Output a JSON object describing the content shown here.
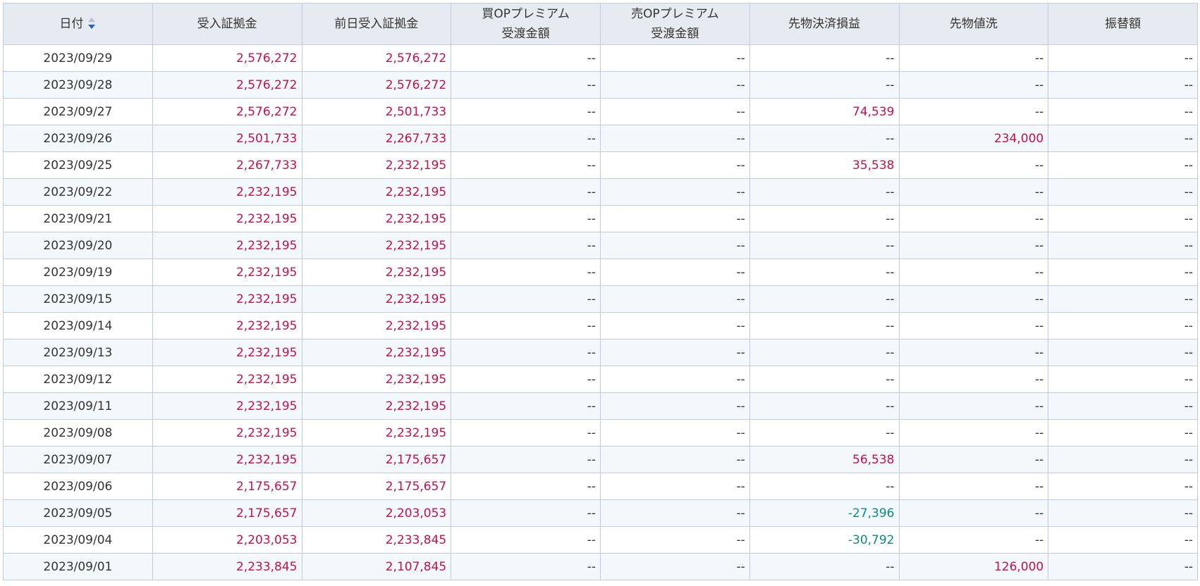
{
  "table": {
    "headers": [
      {
        "lines": [
          "日付"
        ],
        "sortable": true
      },
      {
        "lines": [
          "受入証拠金"
        ]
      },
      {
        "lines": [
          "前日受入証拠金"
        ]
      },
      {
        "lines": [
          "買OPプレミアム",
          "受渡金額"
        ]
      },
      {
        "lines": [
          "売OPプレミアム",
          "受渡金額"
        ]
      },
      {
        "lines": [
          "先物決済損益"
        ]
      },
      {
        "lines": [
          "先物値洗"
        ]
      },
      {
        "lines": [
          "振替額"
        ]
      }
    ],
    "sort_icon": "sort-desc-icon",
    "rows": [
      [
        "2023/09/29",
        "2,576,272",
        "2,576,272",
        "--",
        "--",
        "--",
        "--",
        "--"
      ],
      [
        "2023/09/28",
        "2,576,272",
        "2,576,272",
        "--",
        "--",
        "--",
        "--",
        "--"
      ],
      [
        "2023/09/27",
        "2,576,272",
        "2,501,733",
        "--",
        "--",
        "74,539",
        "--",
        "--"
      ],
      [
        "2023/09/26",
        "2,501,733",
        "2,267,733",
        "--",
        "--",
        "--",
        "234,000",
        "--"
      ],
      [
        "2023/09/25",
        "2,267,733",
        "2,232,195",
        "--",
        "--",
        "35,538",
        "--",
        "--"
      ],
      [
        "2023/09/22",
        "2,232,195",
        "2,232,195",
        "--",
        "--",
        "--",
        "--",
        "--"
      ],
      [
        "2023/09/21",
        "2,232,195",
        "2,232,195",
        "--",
        "--",
        "--",
        "--",
        "--"
      ],
      [
        "2023/09/20",
        "2,232,195",
        "2,232,195",
        "--",
        "--",
        "--",
        "--",
        "--"
      ],
      [
        "2023/09/19",
        "2,232,195",
        "2,232,195",
        "--",
        "--",
        "--",
        "--",
        "--"
      ],
      [
        "2023/09/15",
        "2,232,195",
        "2,232,195",
        "--",
        "--",
        "--",
        "--",
        "--"
      ],
      [
        "2023/09/14",
        "2,232,195",
        "2,232,195",
        "--",
        "--",
        "--",
        "--",
        "--"
      ],
      [
        "2023/09/13",
        "2,232,195",
        "2,232,195",
        "--",
        "--",
        "--",
        "--",
        "--"
      ],
      [
        "2023/09/12",
        "2,232,195",
        "2,232,195",
        "--",
        "--",
        "--",
        "--",
        "--"
      ],
      [
        "2023/09/11",
        "2,232,195",
        "2,232,195",
        "--",
        "--",
        "--",
        "--",
        "--"
      ],
      [
        "2023/09/08",
        "2,232,195",
        "2,232,195",
        "--",
        "--",
        "--",
        "--",
        "--"
      ],
      [
        "2023/09/07",
        "2,232,195",
        "2,175,657",
        "--",
        "--",
        "56,538",
        "--",
        "--"
      ],
      [
        "2023/09/06",
        "2,175,657",
        "2,175,657",
        "--",
        "--",
        "--",
        "--",
        "--"
      ],
      [
        "2023/09/05",
        "2,175,657",
        "2,203,053",
        "--",
        "--",
        "-27,396",
        "--",
        "--"
      ],
      [
        "2023/09/04",
        "2,203,053",
        "2,233,845",
        "--",
        "--",
        "-30,792",
        "--",
        "--"
      ],
      [
        "2023/09/01",
        "2,233,845",
        "2,107,845",
        "--",
        "--",
        "--",
        "126,000",
        "--"
      ]
    ]
  },
  "colors": {
    "positive": "#c8104a",
    "negative": "#0f8a7e",
    "header_bg": "#e6eaf1",
    "alt_row_bg": "#f3f8fc",
    "border": "#c3cad8",
    "sort_active": "#1e62c8"
  }
}
